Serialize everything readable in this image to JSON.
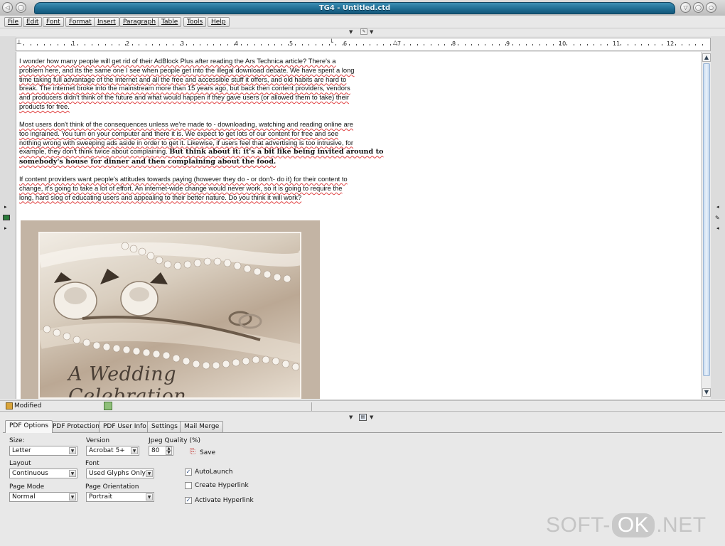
{
  "window": {
    "title": "TG4 - Untitled.ctd"
  },
  "menu": [
    "File",
    "Edit",
    "Font",
    "Format",
    "Insert",
    "Paragraph",
    "Table",
    "Tools",
    "Help"
  ],
  "ruler": {
    "numbers": [
      "1",
      "2",
      "3",
      "4",
      "5",
      "6",
      "7",
      "8",
      "9",
      "10",
      "11",
      "12"
    ]
  },
  "document": {
    "paragraphs": [
      {
        "lines": [
          "I wonder how many people will get rid of their AdBlock Plus after reading the Ars Technica article? There's a",
          "problem here, and its the same one I see when people get into the illegal download debate. We have spent a long",
          "time taking full advantage of the internet and all the free and accessible stuff it offers, and old habits are hard to",
          "break. The internet broke into the mainstream more than 15 years ago,  but back then content providers, vendors",
          "and producers didn't think of the future and what would happen if they gave users (or allowed them to take) their",
          "products for free."
        ]
      },
      {
        "lines": [
          "Most users don't think of the consequences unless we're made to - downloading, watching and reading online are",
          "too ingrained. You turn on your computer and there it is. We expect to get lots of our content for free and see",
          "nothing wrong with sweeping ads aside in order to get it. Likewise, if users feel that advertising is too intrusive, for"
        ],
        "mixed_line": {
          "normal": "example, they don't think twice about complaining. ",
          "bold": "But think about it:  it's a bit like being invited around to"
        },
        "bold_line": "somebody's house for dinner and then complaining about the food."
      },
      {
        "lines": [
          "If content providers want people's attitudes towards paying (however they do - or don't- do it) for their content to",
          "change, it's going to take a lot of effort. An internet-wide change would never work, so it is going to require the",
          "long, hard slog of educating users and appealing to their better nature. Do you think it will work?"
        ]
      }
    ],
    "image_caption": "A Wedding Celebration"
  },
  "status": {
    "text": "Modified"
  },
  "panel": {
    "tabs": [
      "PDF Options",
      "PDF Protection",
      "PDF User Info",
      "Settings",
      "Mail Merge"
    ],
    "active_tab": "PDF Options",
    "fields": {
      "size": {
        "label": "Size:",
        "value": "Letter"
      },
      "version": {
        "label": "Version",
        "value": "Acrobat 5+"
      },
      "jpeg_quality": {
        "label": "Jpeg Quality (%)",
        "value": "80"
      },
      "save_label": "Save",
      "layout": {
        "label": "Layout",
        "value": "Continuous"
      },
      "font": {
        "label": "Font",
        "value": "Used Glyphs Only"
      },
      "page_mode": {
        "label": "Page Mode",
        "value": "Normal"
      },
      "page_orientation": {
        "label": "Page Orientation",
        "value": "Portrait"
      }
    },
    "checkboxes": [
      {
        "label": "AutoLaunch",
        "checked": true
      },
      {
        "label": "Create Hyperlink",
        "checked": false
      },
      {
        "label": "Activate Hyperlink",
        "checked": true
      }
    ]
  },
  "watermark": {
    "left": "SOFT-",
    "middle": "OK",
    "right": ".NET"
  },
  "colors": {
    "title_bar": "#1e6d93",
    "scroll_thumb": "#c9dcf0",
    "image_sepia": "#c3b4a4",
    "spell_underline": "#e04040"
  }
}
